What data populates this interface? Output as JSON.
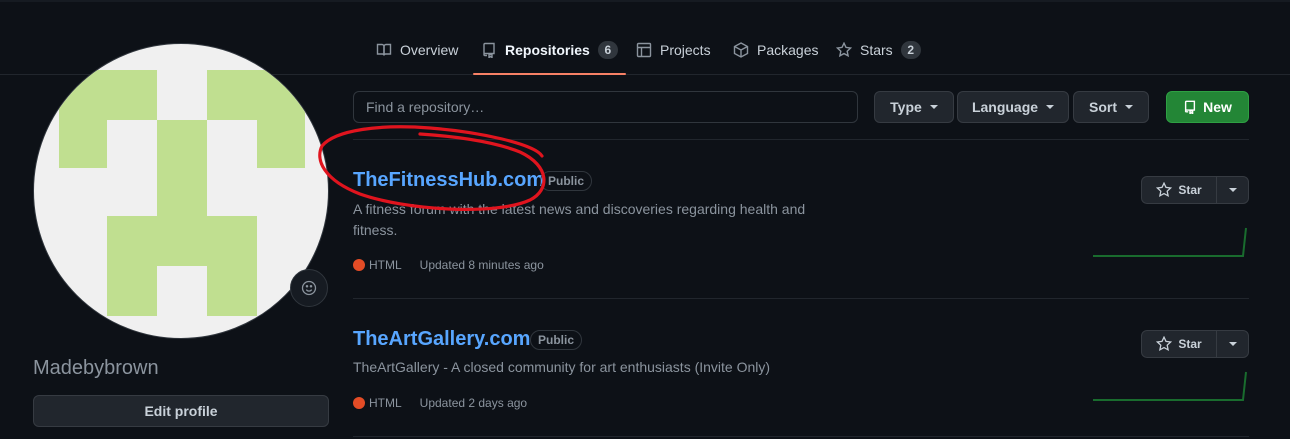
{
  "nav": {
    "tabs": [
      {
        "label": "Overview",
        "icon": "book-icon"
      },
      {
        "label": "Repositories",
        "icon": "repo-icon",
        "count": "6",
        "selected": true
      },
      {
        "label": "Projects",
        "icon": "table-icon"
      },
      {
        "label": "Packages",
        "icon": "package-icon"
      },
      {
        "label": "Stars",
        "icon": "star-icon",
        "count": "2"
      }
    ]
  },
  "profile": {
    "username": "Madebybrown",
    "edit_label": "Edit profile",
    "avatar_colors": {
      "background": "#f0f0f0",
      "pattern": "#c0df90"
    }
  },
  "toolbar": {
    "search_placeholder": "Find a repository…",
    "type_label": "Type",
    "language_label": "Language",
    "sort_label": "Sort",
    "new_label": "New"
  },
  "repos": [
    {
      "name": "TheFitnessHub.com",
      "visibility": "Public",
      "description": "A fitness forum with the latest news and discoveries regarding health and fitness.",
      "language": "HTML",
      "language_color": "#e34c26",
      "updated": "Updated 8 minutes ago",
      "star_label": "Star"
    },
    {
      "name": "TheArtGallery.com",
      "visibility": "Public",
      "description": "TheArtGallery - A closed community for art enthusiasts (Invite Only)",
      "language": "HTML",
      "language_color": "#e34c26",
      "updated": "Updated 2 days ago",
      "star_label": "Star"
    }
  ],
  "colors": {
    "accent_link": "#58a6ff",
    "primary_button": "#238636",
    "tab_underline": "#f78166",
    "annotation": "#e0141e"
  }
}
